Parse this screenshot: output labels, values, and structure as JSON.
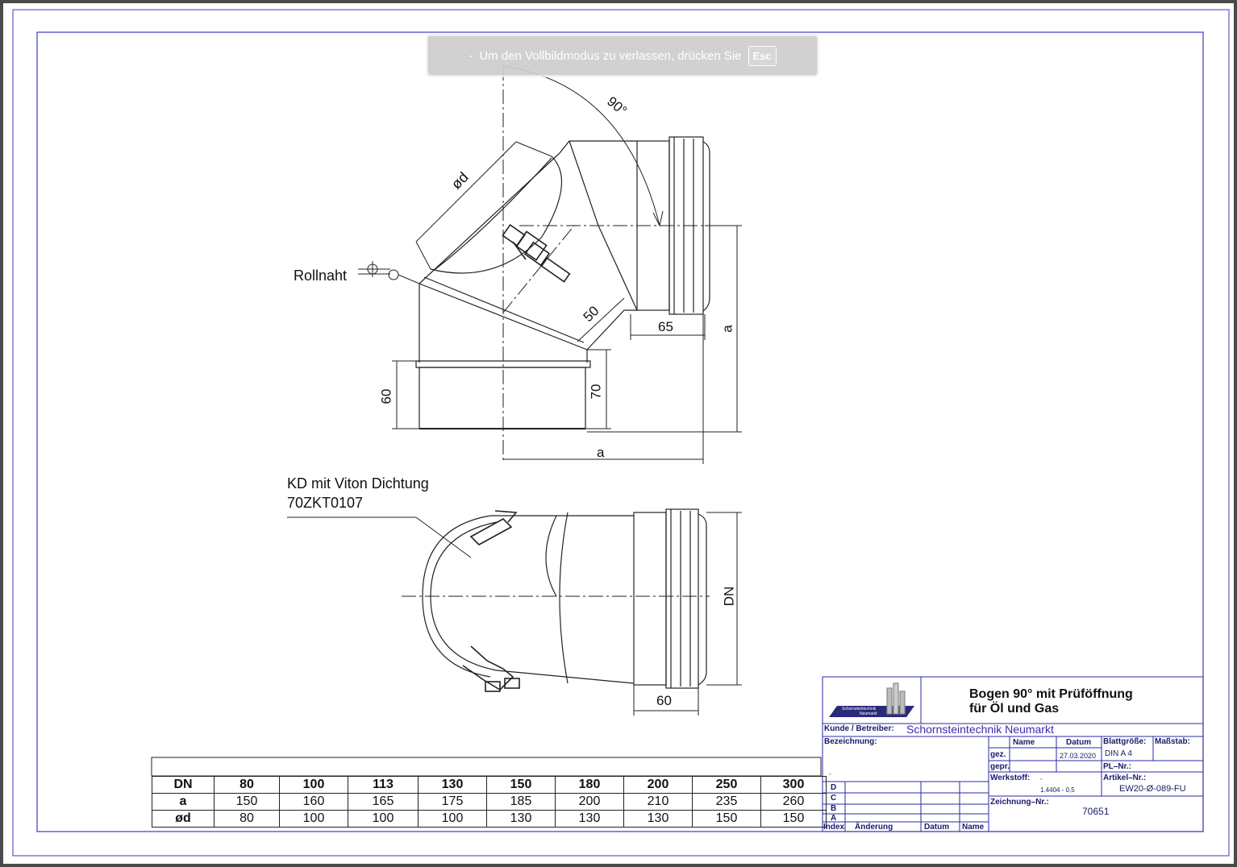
{
  "banner": {
    "prefix": "-",
    "text": "Um den Vollbildmodus zu verlassen, drücken Sie",
    "key": "Esc"
  },
  "drawing": {
    "angle_label": "90°",
    "od_label": "ød",
    "rollnaht_label": "Rollnaht",
    "dim_50": "50",
    "dim_65": "65",
    "dim_a_vertical": "a",
    "dim_60_left": "60",
    "dim_70": "70",
    "dim_a_horizontal": "a",
    "kd_label_line1": "KD mit Viton Dichtung",
    "kd_label_line2": "70ZKT0107",
    "dim_dn": "DN",
    "dim_60_bottom": "60"
  },
  "table": {
    "header": [
      "DN",
      "80",
      "100",
      "113",
      "130",
      "150",
      "180",
      "200",
      "250",
      "300"
    ],
    "rows": [
      [
        "a",
        "150",
        "160",
        "165",
        "175",
        "185",
        "200",
        "210",
        "235",
        "260"
      ],
      [
        "ød",
        "80",
        "100",
        "100",
        "100",
        "130",
        "130",
        "130",
        "150",
        "150"
      ]
    ]
  },
  "title_block": {
    "logo_line1": "Schornsteintechnik",
    "logo_line2": "Neumarkt",
    "title_line1": "Bogen 90° mit Prüföffnung",
    "title_line2": "für Öl und Gas",
    "kunde_label": "Kunde / Betreiber:",
    "kunde_value": "Schornsteintechnik Neumarkt",
    "bezeichnung_label": "Bezeichnung:",
    "bezeichnung_value": "-",
    "col_name": "Name",
    "col_datum": "Datum",
    "gez_label": "gez.",
    "gez_date": "27.03.2020",
    "gepr_label": "gepr.",
    "blattgroesse_label": "Blattgröße:",
    "blattgroesse_value": "DIN A 4",
    "massstab_label": "Maßstab:",
    "pl_label": "PL–Nr.:",
    "werkstoff_label": "Werkstoff:",
    "werkstoff_dash": "-",
    "werkstoff_value": "1.4404 - 0,5",
    "artikel_label": "Artikel–Nr.:",
    "artikel_value": "EW20-Ø-089-FU",
    "zeichnung_label": "Zeichnung–Nr.:",
    "zeichnung_value": "70651",
    "rev_d": "D",
    "rev_c": "C",
    "rev_b": "B",
    "rev_a": "A",
    "index_label": "Index",
    "aenderung_label": "Änderung",
    "datum_label": "Datum",
    "name_label": "Name"
  }
}
